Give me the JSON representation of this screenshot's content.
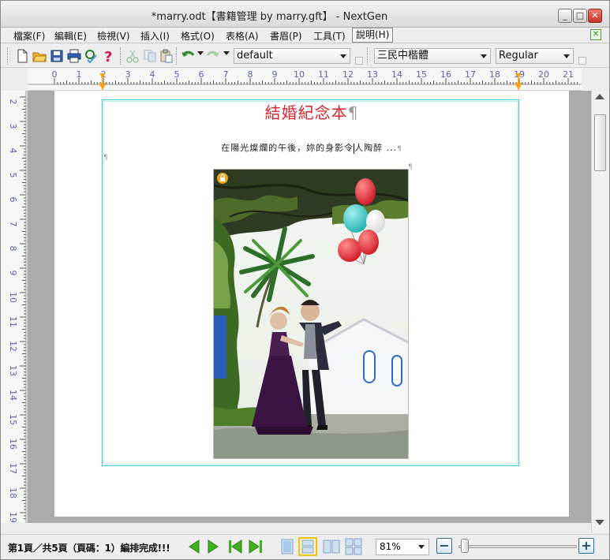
{
  "window": {
    "title": "*marry.odt【書籍管理 by marry.gft】 - NextGen",
    "minimize_label": "_",
    "maximize_label": "□",
    "close_label": "✕"
  },
  "menu": {
    "items": [
      {
        "label": "檔案(F)"
      },
      {
        "label": "編輯(E)"
      },
      {
        "label": "檢視(V)"
      },
      {
        "label": "插入(I)"
      },
      {
        "label": "格式(O)"
      },
      {
        "label": "表格(A)"
      },
      {
        "label": "書眉(P)"
      },
      {
        "label": "工具(T)"
      },
      {
        "label": "說明(H)"
      }
    ],
    "mdi_close_label": "✕"
  },
  "toolbar": {
    "icons": [
      "new-document-icon",
      "open-folder-icon",
      "save-icon",
      "print-icon",
      "spell-check-icon",
      "help-icon",
      "cut-icon",
      "copy-icon",
      "paste-icon",
      "undo-icon",
      "redo-icon"
    ],
    "style_value": "default",
    "font_value": "三民中楷體",
    "font_style_value": "Regular"
  },
  "ruler": {
    "h_labels": [
      "0",
      "1",
      "2",
      "3",
      "4",
      "5",
      "6",
      "7",
      "8",
      "9",
      "10",
      "11",
      "12",
      "13",
      "14",
      "15",
      "16",
      "17",
      "18",
      "19",
      "20",
      "21"
    ],
    "v_labels": [
      "2",
      "3",
      "4",
      "5",
      "6",
      "7",
      "8",
      "9",
      "10",
      "11",
      "12",
      "13",
      "14",
      "15",
      "16",
      "17",
      "18",
      "19"
    ]
  },
  "document": {
    "title": "結婚紀念本",
    "title_mark": "¶",
    "paragraph_before": "在陽光燦爛的午後，妳的身影令",
    "paragraph_after": "人陶醉 ...",
    "paragraph_mark": "¶",
    "side_mark": "¶"
  },
  "status": {
    "text": "第1頁／共5頁（頁碼：1）編排完成!!!",
    "zoom_value": "81%",
    "zoom_level_percent": 81,
    "zoom_minus": "−",
    "zoom_plus": "+"
  },
  "colors": {
    "title_red": "#d8262e",
    "frame_cyan": "#39c9d8",
    "nav_green": "#3fae1f",
    "accent_orange": "#f0a41a"
  }
}
